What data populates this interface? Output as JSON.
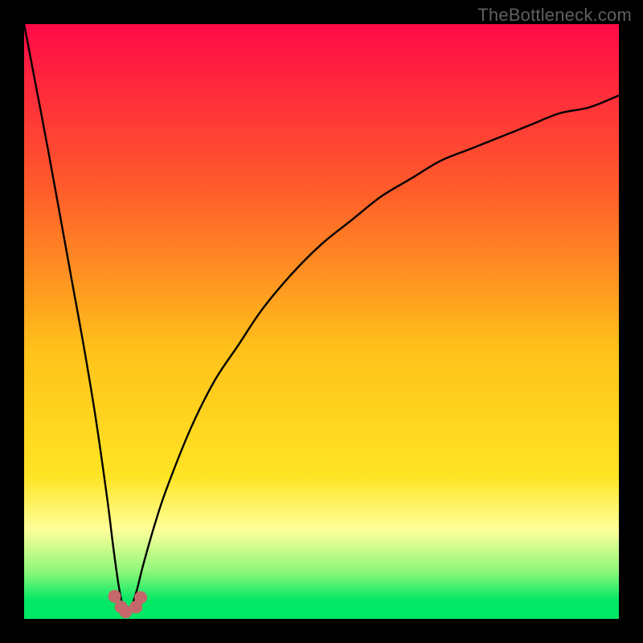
{
  "watermark": "TheBottleneck.com",
  "colors": {
    "top": "#ff0a47",
    "upper_mid": "#ff5d2a",
    "mid": "#ffc21a",
    "lower_mid": "#ffe424",
    "pale": "#feff9a",
    "green_light": "#8ef77a",
    "green": "#00e865",
    "frame": "#000000",
    "curve": "#000000",
    "dot": "#c5676b"
  },
  "chart_data": {
    "type": "line",
    "title": "",
    "xlabel": "",
    "ylabel": "",
    "xlim": [
      0,
      100
    ],
    "ylim": [
      0,
      100
    ],
    "note": "Bottleneck-style V-curve. Minimum near x≈17. Left branch steep to top-left corner; right branch rises asymptotically toward ~88% at right edge. Values estimated from pixels (no axis ticks shown).",
    "series": [
      {
        "name": "bottleneck-curve",
        "x": [
          0,
          4,
          8,
          10,
          12,
          14,
          15,
          16,
          17,
          18,
          19,
          20,
          22,
          24,
          28,
          32,
          36,
          40,
          45,
          50,
          55,
          60,
          65,
          70,
          75,
          80,
          85,
          90,
          95,
          100
        ],
        "y": [
          100,
          79,
          57,
          46,
          34,
          20,
          12,
          5,
          1,
          2,
          5,
          9,
          16,
          22,
          32,
          40,
          46,
          52,
          58,
          63,
          67,
          71,
          74,
          77,
          79,
          81,
          83,
          85,
          86,
          88
        ]
      }
    ],
    "dots": [
      {
        "x": 15.2,
        "y": 3.8
      },
      {
        "x": 16.3,
        "y": 2.0
      },
      {
        "x": 17.1,
        "y": 1.2
      },
      {
        "x": 18.8,
        "y": 2.0
      },
      {
        "x": 19.6,
        "y": 3.6
      }
    ],
    "gradient_stops": [
      {
        "pct": 0,
        "key": "top"
      },
      {
        "pct": 28,
        "key": "upper_mid"
      },
      {
        "pct": 55,
        "key": "mid"
      },
      {
        "pct": 76,
        "key": "lower_mid"
      },
      {
        "pct": 85,
        "key": "pale"
      },
      {
        "pct": 92,
        "key": "green_light"
      },
      {
        "pct": 97,
        "key": "green"
      },
      {
        "pct": 100,
        "key": "green"
      }
    ]
  }
}
